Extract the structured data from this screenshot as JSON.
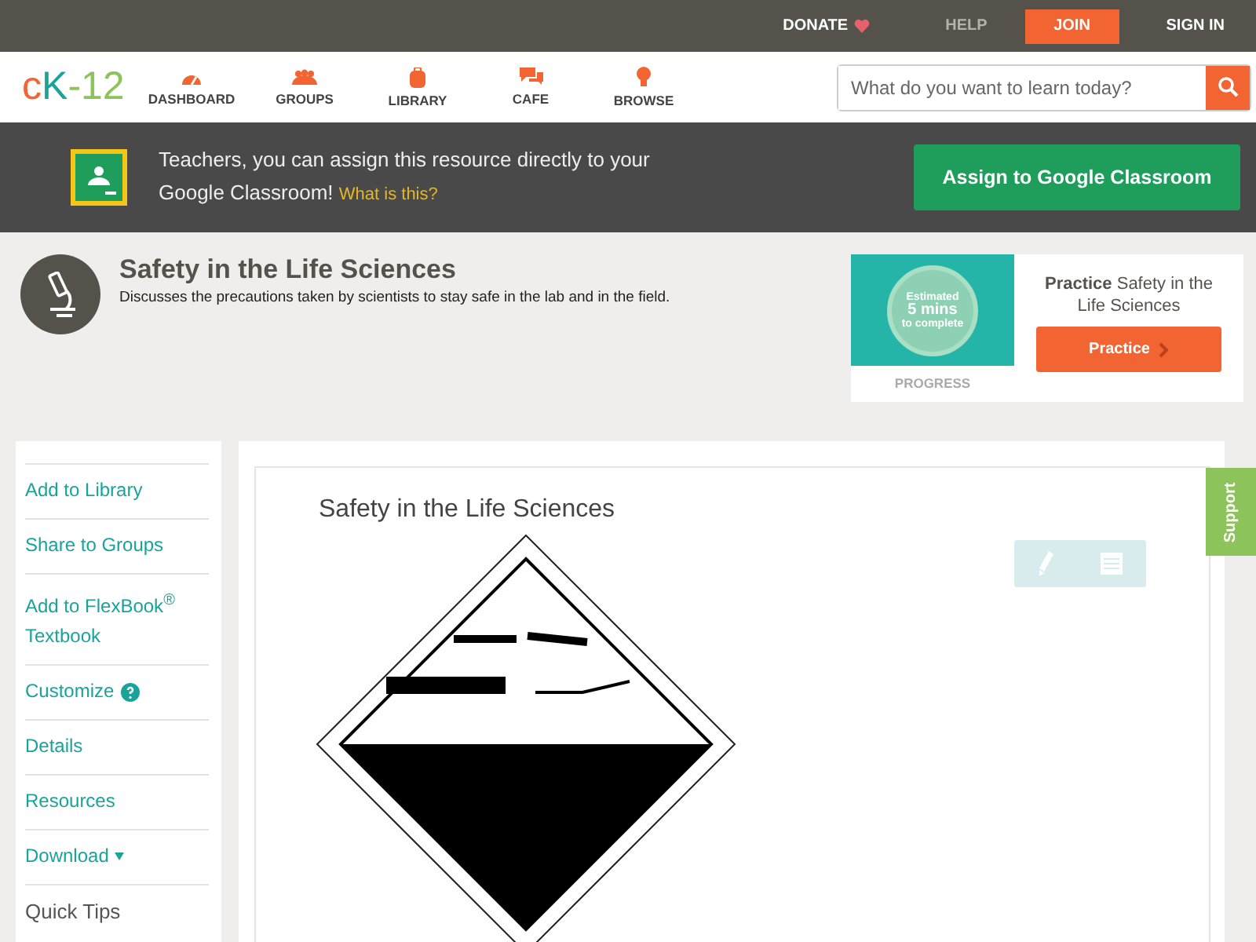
{
  "top_bar": {
    "donate": "DONATE",
    "help": "HELP",
    "join": "JOIN",
    "sign_in": "SIGN IN"
  },
  "logo": {
    "part_1": "c",
    "part_2": "K",
    "part_3": "-12"
  },
  "nav": [
    {
      "label": "DASHBOARD",
      "kind": "gauge"
    },
    {
      "label": "GROUPS",
      "kind": "people"
    },
    {
      "label": "LIBRARY",
      "kind": "backpack"
    },
    {
      "label": "CAFE",
      "kind": "chat"
    },
    {
      "label": "BROWSE",
      "kind": "bulb"
    }
  ],
  "search": {
    "placeholder": "What do you want to learn today?"
  },
  "classroom_banner": {
    "text": "Teachers, you can assign this resource directly to your Google Classroom!",
    "link": "What is this?",
    "button": "Assign to Google Classroom"
  },
  "header": {
    "title": "Safety in the Life Sciences",
    "description": "Discusses the precautions taken by scientists to stay safe in the lab and in the field."
  },
  "practice_card": {
    "estimate_top": "Estimated",
    "estimate_value": "5 mins",
    "estimate_bottom": "to complete",
    "progress": "PROGRESS",
    "heading": "**Practice** Safety in the Life Sciences",
    "button": "Practice"
  },
  "sidebar": [
    {
      "label": "Add to Library",
      "kind": "link"
    },
    {
      "label": "Share to Groups",
      "kind": "link"
    },
    {
      "label": "Add to FlexBook$^{®}$ Textbook",
      "kind": "link"
    },
    {
      "label": "Customize",
      "kind": "help"
    },
    {
      "label": "Details",
      "kind": "link"
    },
    {
      "label": "Resources",
      "kind": "link"
    },
    {
      "label": "Download",
      "kind": "dropdown"
    },
    {
      "label": "Quick Tips",
      "kind": "heading"
    }
  ],
  "content": {
    "title": "Safety in the Life Sciences"
  },
  "support_tab": "Support"
}
